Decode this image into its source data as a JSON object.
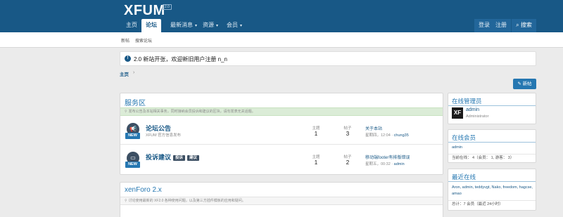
{
  "header": {
    "logo": "XFUM",
    "logo_badge": "2.0",
    "nav": [
      {
        "label": "主页"
      },
      {
        "label": "论坛"
      },
      {
        "label": "最新消息"
      },
      {
        "label": "资源"
      },
      {
        "label": "会员"
      }
    ],
    "login": "登录",
    "register": "注册",
    "search": "搜索"
  },
  "subnav": {
    "items": [
      "新帖",
      "搜索论坛"
    ]
  },
  "notice": "2.0 新站开张，欢迎新旧用户注册 n_n",
  "breadcrumb": {
    "home": "主页",
    "sep": "›"
  },
  "new_post_button": "新帖",
  "categories": [
    {
      "title": "服务区",
      "description": "发布公告及本站相关事务，同时接纳会员投诉和建议的区块，请勿发表无关话题。",
      "forums": [
        {
          "name": "论坛公告",
          "subtitle": "XFUM 官方信息发布",
          "icon": "megaphone-icon",
          "new": "NEW",
          "threads_label": "主题",
          "threads": "1",
          "posts_label": "帖子",
          "posts": "3",
          "last_title": "关于本站",
          "last_time": "星期四，12:04 · ",
          "last_user": "chung35"
        },
        {
          "name": "投诉建议",
          "tags": [
            "投诉",
            "建议"
          ],
          "icon": "monitor-icon",
          "new": "NEW",
          "threads_label": "主题",
          "threads": "1",
          "posts_label": "帖子",
          "posts": "2",
          "last_title": "移动端footer有排版错误",
          "last_time": "星期五，00:32 · ",
          "last_user": "admin"
        }
      ]
    },
    {
      "title": "xenForo 2.x",
      "description": "讨论使用最新的 XF2.0 各种使用问题，以及第三方插件模板的应用和疑问。"
    }
  ],
  "sidebar": {
    "staff": {
      "title": "在线管理员",
      "name": "admin",
      "role": "Administrator",
      "avatar": "XF"
    },
    "online": {
      "title": "在线会员",
      "members": "admin",
      "footer": "当前在线： 4（会员： 1, 游客： 3）"
    },
    "recent": {
      "title": "最近在线",
      "members": "Aron, admin, teddyvgt, Nako, freedom, hagcse, amao",
      "footer": "总计：7 会员（最近 24小时）"
    }
  },
  "colors": {
    "header": "#185886",
    "accent": "#2577b1",
    "desc_green": "#dbecd7"
  }
}
